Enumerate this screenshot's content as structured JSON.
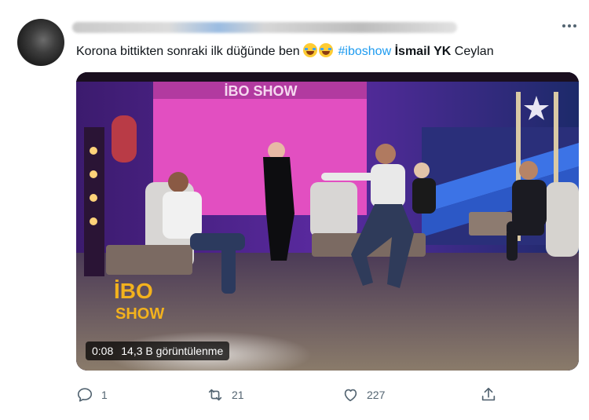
{
  "tweet": {
    "text": {
      "part1": "Korona  bittikten sonraki ilk düğünde ben ",
      "hashtag": "#iboshow",
      "mention_bold": "İsmail YK",
      "tail": " Ceylan"
    },
    "emojis": [
      "face-with-tears-of-joy",
      "face-with-tears-of-joy"
    ],
    "video": {
      "timestamp": "0:08",
      "views": "14,3 B görüntülenme",
      "backdrop_text": "İBO SHOW",
      "logo_line1": "İBO",
      "logo_line2": "SHOW"
    },
    "actions": {
      "reply_count": "1",
      "retweet_count": "21",
      "like_count": "227"
    }
  },
  "icons": {
    "more": "more-horizontal-icon",
    "reply": "speech-bubble-icon",
    "retweet": "retweet-arrows-icon",
    "like": "heart-icon",
    "share": "share-upload-icon"
  },
  "colors": {
    "link": "#1d9bf0",
    "muted": "#536471",
    "text": "#0f1419"
  }
}
